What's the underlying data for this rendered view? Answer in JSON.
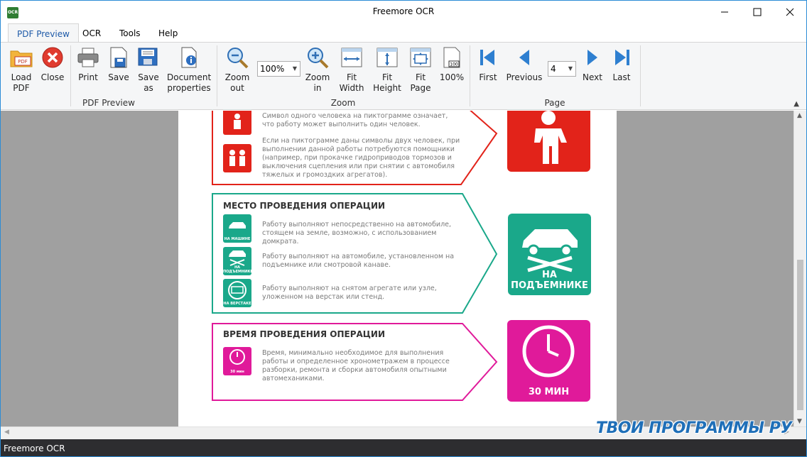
{
  "window": {
    "title": "Freemore OCR",
    "icon_text": "OCR",
    "controls": [
      "minimize-icon",
      "maximize-icon",
      "close-icon"
    ]
  },
  "tabs": [
    {
      "label": "PDF Preview",
      "active": true
    },
    {
      "label": "OCR",
      "active": false
    },
    {
      "label": "Tools",
      "active": false
    },
    {
      "label": "Help",
      "active": false
    }
  ],
  "ribbon": {
    "groups": {
      "pdf_preview": "PDF Preview",
      "zoom": "Zoom",
      "page": "Page"
    },
    "buttons": {
      "load_pdf": [
        "Load",
        "PDF"
      ],
      "close": [
        "Close",
        ""
      ],
      "print": [
        "Print",
        ""
      ],
      "save": [
        "Save",
        ""
      ],
      "save_as": [
        "Save",
        "as"
      ],
      "document_properties": [
        "Document",
        "properties"
      ],
      "zoom_out": [
        "Zoom",
        "out"
      ],
      "zoom_in": [
        "Zoom",
        "in"
      ],
      "fit_width": [
        "Fit",
        "Width"
      ],
      "fit_height": [
        "Fit",
        "Height"
      ],
      "fit_page": [
        "Fit",
        "Page"
      ],
      "zoom_100": [
        "100%",
        ""
      ],
      "first": [
        "First",
        ""
      ],
      "previous": [
        "Previous",
        ""
      ],
      "next": [
        "Next",
        ""
      ],
      "last": [
        "Last",
        ""
      ]
    },
    "zoom_value": "100%",
    "page_value": "4",
    "zoom_100_icon_text": "100",
    "load_pdf_icon_text": "PDF"
  },
  "page_content": {
    "people": {
      "text1": "Символ одного человека на пиктограмме означает, что работу может выполнить один человек.",
      "text2": "Если на пиктограмме даны символы двух человек, при выполнении данной работы потребуются помощники (например, при прокачке гидроприводов тормозов и выключения сцепления или при снятии с автомобиля тяжелых и громоздких агрегатов)."
    },
    "place": {
      "title": "МЕСТО ПРОВЕДЕНИЯ ОПЕРАЦИИ",
      "text1": "Работу выполняют непосредственно на автомобиле, стоящем на земле, возможно, с использованием домкрата.",
      "text2": "Работу выполняют на автомобиле, установленном на подъемнике или смотровой канаве.",
      "text3": "Работу выполняют на снятом агрегате или узле, уложенном на верстак или стенд.",
      "icon1_cap": "НА МАШИНЕ",
      "icon2_cap": "НА ПОДЪЕМНИКЕ",
      "icon3_cap": "НА ВЕРСТАКЕ",
      "big_caption": "НА ПОДЪЕМНИКЕ"
    },
    "time": {
      "title": "ВРЕМЯ ПРОВЕДЕНИЯ ОПЕРАЦИИ",
      "text1": "Время, минимально необходимое для выполнения работы и определенное хронометражем в процессе разборки, ремонта и сборки автомобиля опытными автомеханиками.",
      "icon_cap": "30 мин",
      "big_caption": "30 МИН"
    }
  },
  "colors": {
    "red": "#e2231a",
    "green": "#1aa88a",
    "magenta": "#e01a9a",
    "accent": "#1e5aa8"
  },
  "statusbar": {
    "text": "Freemore OCR"
  },
  "watermark": "ТВОИ ПРОГРАММЫ РУ"
}
